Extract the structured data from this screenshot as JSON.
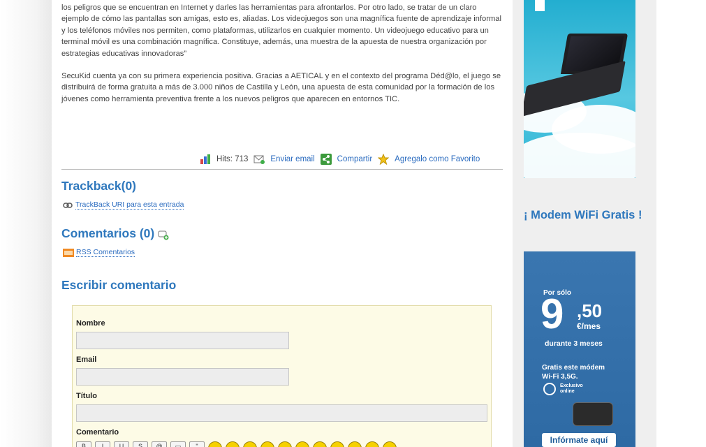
{
  "article": {
    "paragraph1": "los peligros que se encuentran en Internet y darles las herramientas para afrontarlos. Por otro lado, se tratar de un claro ejemplo de cómo las pantallas son amigas, esto es, aliadas. Los videojuegos son una magnífica fuente de aprendizaje informal y los teléfonos móviles nos permiten, como plataformas, utilizarlos en cualquier momento. Un videojuego educativo para un terminal móvil es una combinación magnífica. Constituye, además, una muestra de la apuesta de nuestra organización por estrategias educativas innovadoras”",
    "paragraph2": "SecuKid cuenta ya con su primera experiencia positiva. Gracias a AETICAL y en el contexto del programa Déd@lo, el juego se distribuirá de forma gratuita a más de 3.000 niños de Castilla y León, una apuesta de esta comunidad por la formación de los jóvenes como herramienta preventiva frente a los nuevos peligros que aparecen en entornos TIC."
  },
  "meta": {
    "hits": "Hits: 713",
    "email": "Enviar email",
    "share": "Compartir",
    "favorite": "Agregalo como Favorito"
  },
  "trackback": {
    "heading": "Trackback(0)",
    "link": "TrackBack URI para esta entrada"
  },
  "comments": {
    "heading": "Comentarios (0)",
    "rss": "RSS Comentarios"
  },
  "form": {
    "heading": "Escribir comentario",
    "name_label": "Nombre",
    "email_label": "Email",
    "title_label": "Título",
    "comment_label": "Comentario"
  },
  "sidebar": {
    "promo_title": "¡ Modem WiFi Gratis !",
    "ad": {
      "por_solo": "Por sólo",
      "price_main": "9",
      "price_cents": ",50",
      "per_month": "€/mes",
      "duration": "durante 3 meses",
      "gratis_line1": "Gratis este módem",
      "gratis_line2": "Wi-Fi 3,5G.",
      "exclusive1": "Exclusivo",
      "exclusive2": "online",
      "cta": "Infórmate aquí"
    }
  },
  "colors": {
    "heading": "#2f78bd",
    "link": "#2a6bbf",
    "form_bg": "#fdfbe6"
  }
}
